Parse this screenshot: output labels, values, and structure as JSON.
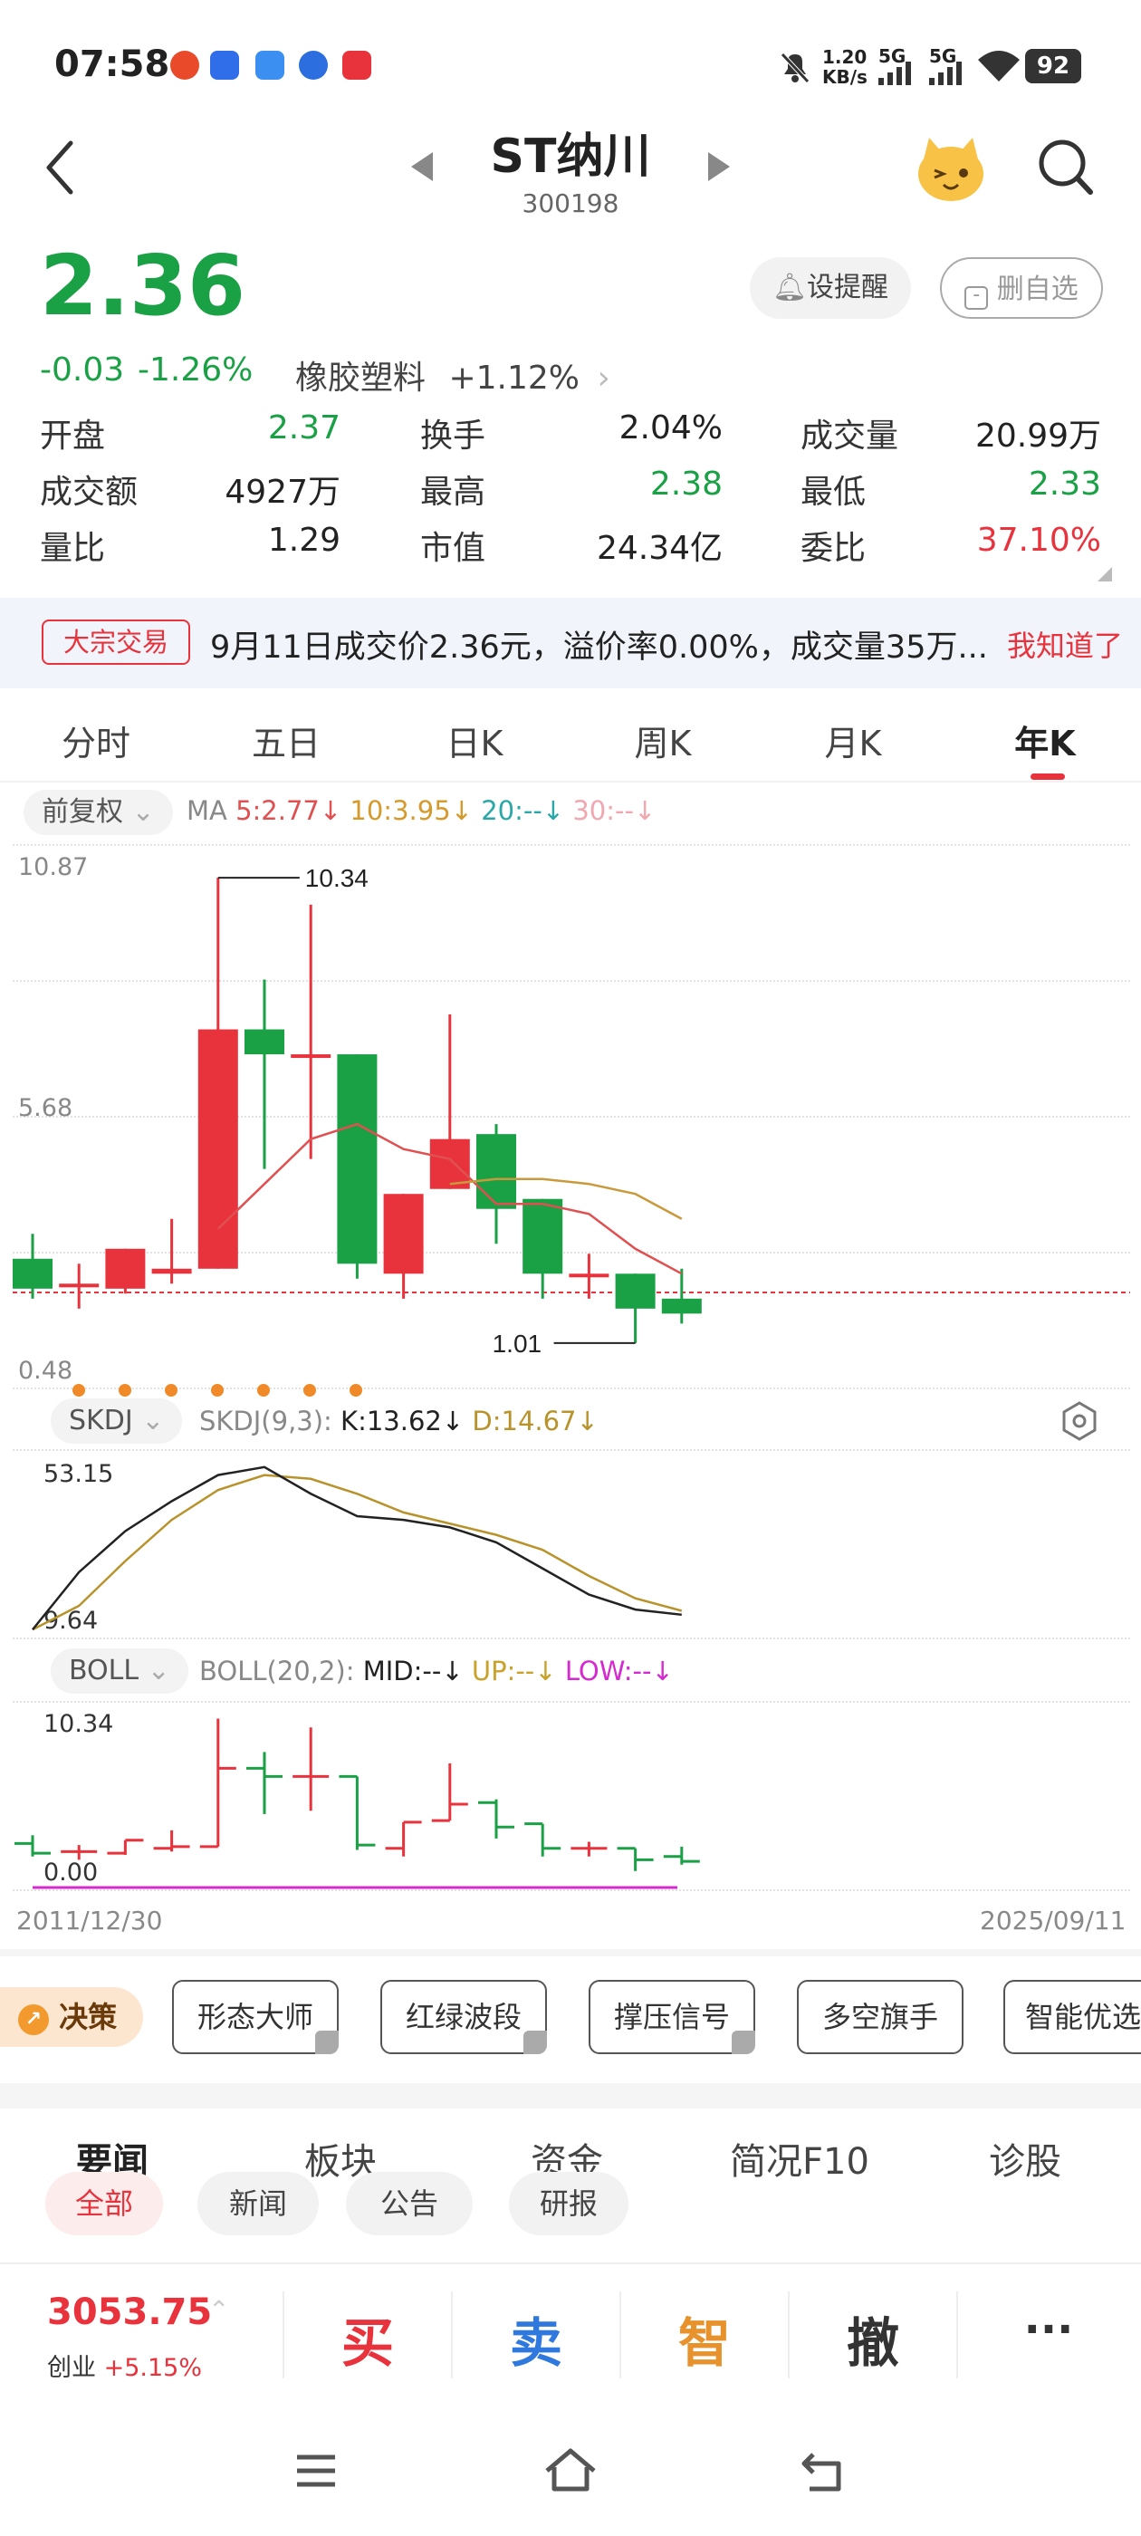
{
  "status_bar": {
    "time": "07:58",
    "net_speed_value": "1.20",
    "net_speed_unit": "KB/s",
    "sim1": "5G",
    "sim2": "5G",
    "battery": "92"
  },
  "header": {
    "title": "ST纳川",
    "code": "300198"
  },
  "quote": {
    "price": "2.36",
    "change": "-0.03",
    "change_pct": "-1.26%",
    "sector_name": "橡胶塑料",
    "sector_change": "+1.12%",
    "set_alert_label": "设提醒",
    "remove_watch_label": "删自选",
    "stats": [
      {
        "label": "开盘",
        "value": "2.37",
        "color": "green"
      },
      {
        "label": "换手",
        "value": "2.04%",
        "color": "dark"
      },
      {
        "label": "成交量",
        "value": "20.99万",
        "color": "dark"
      },
      {
        "label": "成交额",
        "value": "4927万",
        "color": "dark"
      },
      {
        "label": "最高",
        "value": "2.38",
        "color": "green"
      },
      {
        "label": "最低",
        "value": "2.33",
        "color": "green"
      },
      {
        "label": "量比",
        "value": "1.29",
        "color": "dark"
      },
      {
        "label": "市值",
        "value": "24.34亿",
        "color": "dark"
      },
      {
        "label": "委比",
        "value": "37.10%",
        "color": "red"
      }
    ]
  },
  "notice": {
    "tag": "大宗交易",
    "text": "9月11日成交价2.36元，溢价率0.00%，成交量35万...",
    "action": "我知道了"
  },
  "kline_tabs": {
    "items": [
      "分时",
      "五日",
      "日K",
      "周K",
      "月K",
      "年K"
    ],
    "active": "年K"
  },
  "main_chart": {
    "adjust_label": "前复权",
    "ma_label": "MA",
    "ma5": "5:2.77",
    "ma10": "10:3.95",
    "ma20": "20:--",
    "ma30": "30:--",
    "y_top": "10.87",
    "y_mid": "5.68",
    "y_bottom": "0.48",
    "high_label": "10.34",
    "low_label": "1.01"
  },
  "skdj": {
    "selector": "SKDJ",
    "params": "SKDJ(9,3):",
    "k": "K:13.62",
    "d": "D:14.67",
    "y_top": "53.15",
    "y_bottom": "9.64"
  },
  "boll": {
    "selector": "BOLL",
    "params": "BOLL(20,2):",
    "mid": "MID:--",
    "up": "UP:--",
    "low": "LOW:--",
    "y_top": "10.34",
    "y_bottom": "0.00"
  },
  "date_range": {
    "start": "2011/12/30",
    "end": "2025/09/11"
  },
  "strategies": {
    "badge": "决策",
    "items": [
      "形态大师",
      "红绿波段",
      "撑压信号",
      "多空旗手",
      "智能优选"
    ]
  },
  "news": {
    "tabs": [
      "要闻",
      "板块",
      "资金",
      "简况F10",
      "诊股"
    ],
    "active": "要闻",
    "subtabs": [
      "全部",
      "新闻",
      "公告",
      "研报"
    ]
  },
  "trade_bar": {
    "index_value": "3053.75",
    "index_name": "创业",
    "index_change": "+5.15%",
    "buy": "买",
    "sell": "卖",
    "smart": "智",
    "cancel": "撤",
    "more": "···"
  },
  "chart_data": {
    "type": "candlestick",
    "period": "yearly",
    "ylim": [
      0.48,
      10.87
    ],
    "candles": [
      {
        "open": 2.7,
        "close": 2.1,
        "high": 3.2,
        "low": 1.9
      },
      {
        "open": 2.2,
        "close": 2.2,
        "high": 2.6,
        "low": 1.7
      },
      {
        "open": 2.1,
        "close": 2.9,
        "high": 2.9,
        "low": 2.0
      },
      {
        "open": 2.4,
        "close": 2.5,
        "high": 3.5,
        "low": 2.2
      },
      {
        "open": 2.5,
        "close": 7.3,
        "high": 10.34,
        "low": 2.5
      },
      {
        "open": 7.3,
        "close": 6.8,
        "high": 8.3,
        "low": 4.5
      },
      {
        "open": 6.8,
        "close": 6.8,
        "high": 9.8,
        "low": 4.7
      },
      {
        "open": 6.8,
        "close": 2.6,
        "high": 6.8,
        "low": 2.3
      },
      {
        "open": 2.4,
        "close": 4.0,
        "high": 4.0,
        "low": 1.9
      },
      {
        "open": 4.1,
        "close": 5.1,
        "high": 7.6,
        "low": 4.1
      },
      {
        "open": 5.2,
        "close": 3.7,
        "high": 5.4,
        "low": 3.0
      },
      {
        "open": 3.9,
        "close": 2.4,
        "high": 3.9,
        "low": 1.9
      },
      {
        "open": 2.4,
        "close": 2.4,
        "high": 2.8,
        "low": 1.9
      },
      {
        "open": 2.4,
        "close": 1.7,
        "high": 2.4,
        "low": 1.01
      },
      {
        "open": 1.9,
        "close": 1.6,
        "high": 2.5,
        "low": 1.4
      }
    ],
    "ma5": [
      null,
      null,
      null,
      null,
      3.3,
      4.2,
      5.1,
      5.4,
      4.9,
      4.7,
      3.8,
      3.8,
      3.6,
      2.9,
      2.4
    ],
    "ma10": [
      null,
      null,
      null,
      null,
      null,
      null,
      null,
      null,
      null,
      4.2,
      4.3,
      4.3,
      4.2,
      4.0,
      3.5
    ],
    "skdj_k": [
      9.64,
      25,
      36,
      44,
      51,
      53.15,
      46,
      40,
      39,
      37,
      33,
      26,
      19,
      15,
      13.62
    ],
    "skdj_d": [
      9.64,
      16,
      28,
      39,
      47,
      51,
      50,
      46,
      41,
      38,
      35,
      31,
      24,
      18,
      14.67
    ]
  }
}
